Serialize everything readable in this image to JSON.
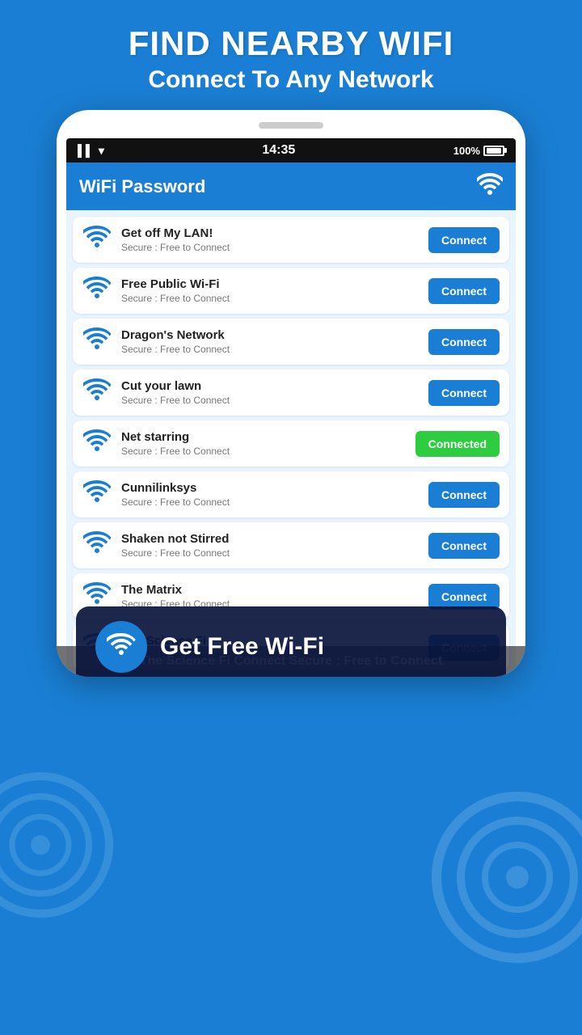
{
  "header": {
    "line1": "FIND NEARBY WIFI",
    "line2": "Connect To Any Network"
  },
  "statusBar": {
    "time": "14:35",
    "battery": "100%",
    "signal": "wifi"
  },
  "appHeader": {
    "title": "WiFi Password"
  },
  "banner": {
    "text": "Get Free Wi-Fi"
  },
  "networks": [
    {
      "name": "Get off My LAN!",
      "security": "Secure :  Free to Connect",
      "status": "connect",
      "btnLabel": "Connect"
    },
    {
      "name": "Free Public Wi-Fi",
      "security": "Secure :  Free to Connect",
      "status": "connect",
      "btnLabel": "Connect"
    },
    {
      "name": "Dragon's Network",
      "security": "Secure :  Free to Connect",
      "status": "connect",
      "btnLabel": "Connect"
    },
    {
      "name": "Cut your lawn",
      "security": "Secure :  Free to Connect",
      "status": "connect",
      "btnLabel": "Connect"
    },
    {
      "name": "Net starring",
      "security": "Secure :  Free to Connect",
      "status": "connected",
      "btnLabel": "Connected"
    },
    {
      "name": "Cunnilinksys",
      "security": "Secure :  Free to Connect",
      "status": "connect",
      "btnLabel": "Connect"
    },
    {
      "name": "Shaken not Stirred",
      "security": "Secure :  Free to Connect",
      "status": "connect",
      "btnLabel": "Connect"
    },
    {
      "name": "The Matrix",
      "security": "Secure :  Free to Connect",
      "status": "connect",
      "btnLabel": "Connect"
    },
    {
      "name": "The Science Fi",
      "security": "Secure :  Free to Connect",
      "status": "connect",
      "btnLabel": "Connect"
    }
  ],
  "bottomLabel": "The Science Fi   Connect Secure :  Free to Connect"
}
